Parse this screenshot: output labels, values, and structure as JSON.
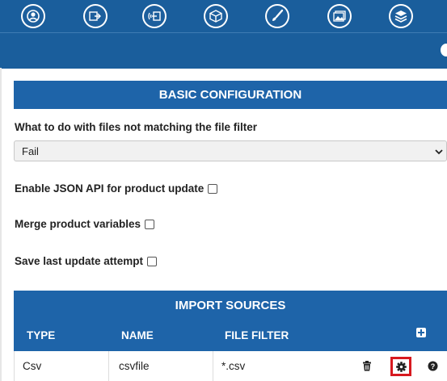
{
  "toolbar": {
    "icons": [
      "portal-badge-icon",
      "feed-out-icon",
      "feed-in-icon",
      "package-box-icon",
      "brush-icon",
      "image-gallery-icon",
      "layers-icon"
    ]
  },
  "basic_configuration": {
    "title": "BASIC CONFIGURATION",
    "unmatched_files_label": "What to do with files not matching the file filter",
    "unmatched_files_value": "Fail",
    "json_api_label": "Enable JSON API for product update",
    "json_api_checked": false,
    "merge_variables_label": "Merge product variables",
    "merge_variables_checked": false,
    "save_attempt_label": "Save last update attempt",
    "save_attempt_checked": false
  },
  "import_sources": {
    "title": "IMPORT SOURCES",
    "columns": [
      "TYPE",
      "NAME",
      "FILE FILTER"
    ],
    "rows": [
      {
        "type": "Csv",
        "name": "csvfile",
        "file_filter": "*.csv"
      }
    ]
  },
  "colors": {
    "primary": "#1a5e9c",
    "section": "#1e64a9",
    "highlight": "#d7191f"
  }
}
